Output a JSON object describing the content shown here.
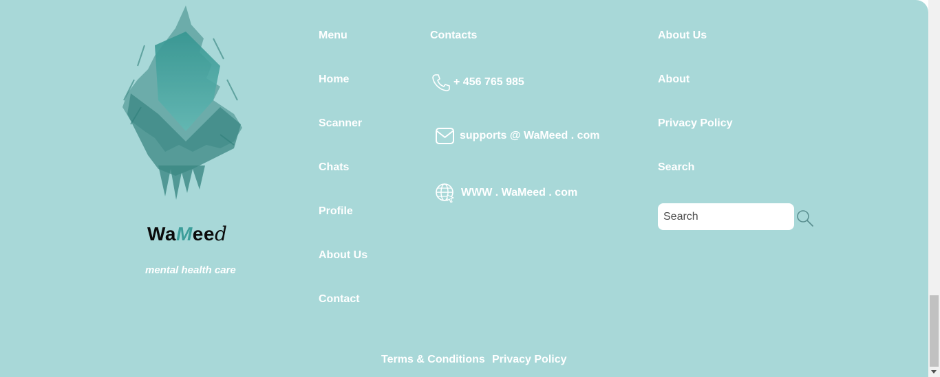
{
  "brand": {
    "name_part1": "Wa",
    "name_part2": "M",
    "name_part3": "ee",
    "name_part4": "d",
    "tagline": "mental health care"
  },
  "menu": {
    "heading": "Menu",
    "items": [
      {
        "label": "Home"
      },
      {
        "label": "Scanner"
      },
      {
        "label": "Chats"
      },
      {
        "label": "Profile"
      },
      {
        "label": "About Us"
      },
      {
        "label": "Contact"
      }
    ]
  },
  "contacts": {
    "heading": "Contacts",
    "phone": "+ 456 765 985",
    "email": "supports @ WaMeed . com",
    "website": "WWW . WaMeed . com"
  },
  "about": {
    "heading": "About Us",
    "items": [
      {
        "label": "About"
      },
      {
        "label": "Privacy Policy"
      },
      {
        "label": "Search"
      }
    ]
  },
  "search": {
    "placeholder": "Search",
    "value": ""
  },
  "bottom": {
    "terms": "Terms & Conditions",
    "privacy": "Privacy Policy"
  },
  "colors": {
    "background": "#a8d8d8",
    "text": "#ffffff",
    "accent": "#3c9e9a",
    "logo_dark": "#2f7f7a"
  },
  "icons": {
    "phone": "phone-icon",
    "email": "envelope-icon",
    "website": "globe-icon",
    "search": "magnifier-icon"
  }
}
